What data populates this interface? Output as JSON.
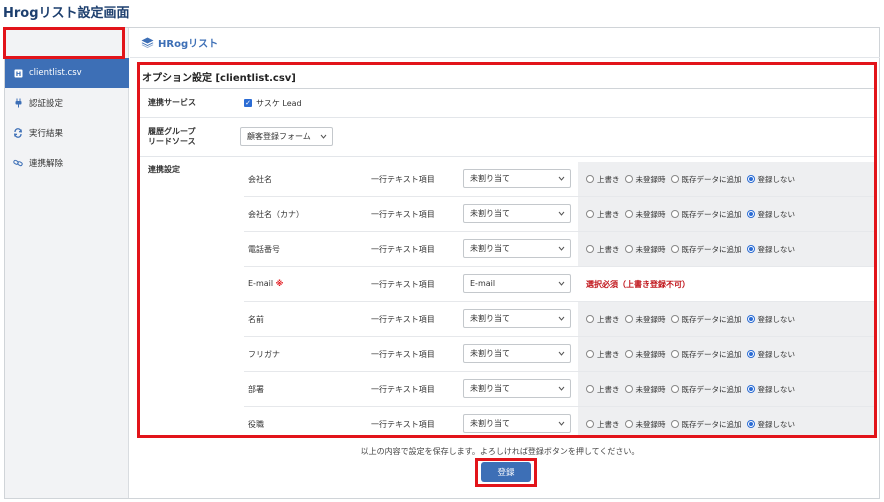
{
  "page_title": "Hrogリスト設定画面",
  "brand": {
    "name": "HRogリスト"
  },
  "sidebar": {
    "items": [
      {
        "label": "clientlist.csv",
        "icon": "file-badge-icon",
        "active": true
      },
      {
        "label": "認証設定",
        "icon": "plug-icon",
        "active": false
      },
      {
        "label": "実行結果",
        "icon": "sync-arrows-icon",
        "active": false
      },
      {
        "label": "連携解除",
        "icon": "unlink-icon",
        "active": false
      }
    ]
  },
  "panel": {
    "title": "オプション設定 [clientlist.csv]",
    "service": {
      "label": "連携サービス",
      "checked": true,
      "value": "サスケ Lead"
    },
    "history": {
      "label_line1": "履歴グループ",
      "label_line2": "リードソース",
      "selected": "顧客登録フォーム"
    },
    "mapping": {
      "label": "連携設定",
      "radio_options": [
        "上書き",
        "未登録時",
        "既存データに追加",
        "登録しない"
      ],
      "fields": [
        {
          "name": "会社名",
          "required": false,
          "type": "一行テキスト項目",
          "selected": "未割り当て",
          "checked": "登録しない"
        },
        {
          "name": "会社名（カナ）",
          "required": false,
          "type": "一行テキスト項目",
          "selected": "未割り当て",
          "checked": "登録しない"
        },
        {
          "name": "電話番号",
          "required": false,
          "type": "一行テキスト項目",
          "selected": "未割り当て",
          "checked": "登録しない"
        },
        {
          "name": "E-mail",
          "required": true,
          "required_mark": "※",
          "type": "一行テキスト項目",
          "selected": "E-mail",
          "note": "選択必須（上書き登録不可）"
        },
        {
          "name": "名前",
          "required": false,
          "type": "一行テキスト項目",
          "selected": "未割り当て",
          "checked": "登録しない"
        },
        {
          "name": "フリガナ",
          "required": false,
          "type": "一行テキスト項目",
          "selected": "未割り当て",
          "checked": "登録しない"
        },
        {
          "name": "部署",
          "required": false,
          "type": "一行テキスト項目",
          "selected": "未割り当て",
          "checked": "登録しない"
        },
        {
          "name": "役職",
          "required": false,
          "type": "一行テキスト項目",
          "selected": "未割り当て",
          "checked": "登録しない"
        }
      ]
    }
  },
  "footer": {
    "message": "以上の内容で設定を保存します。よろしければ登録ボタンを押してください。",
    "save_label": "登録"
  },
  "colors": {
    "accent": "#3d6fb6",
    "highlight": "#e2141a",
    "radio_on": "#2b6cd4"
  }
}
